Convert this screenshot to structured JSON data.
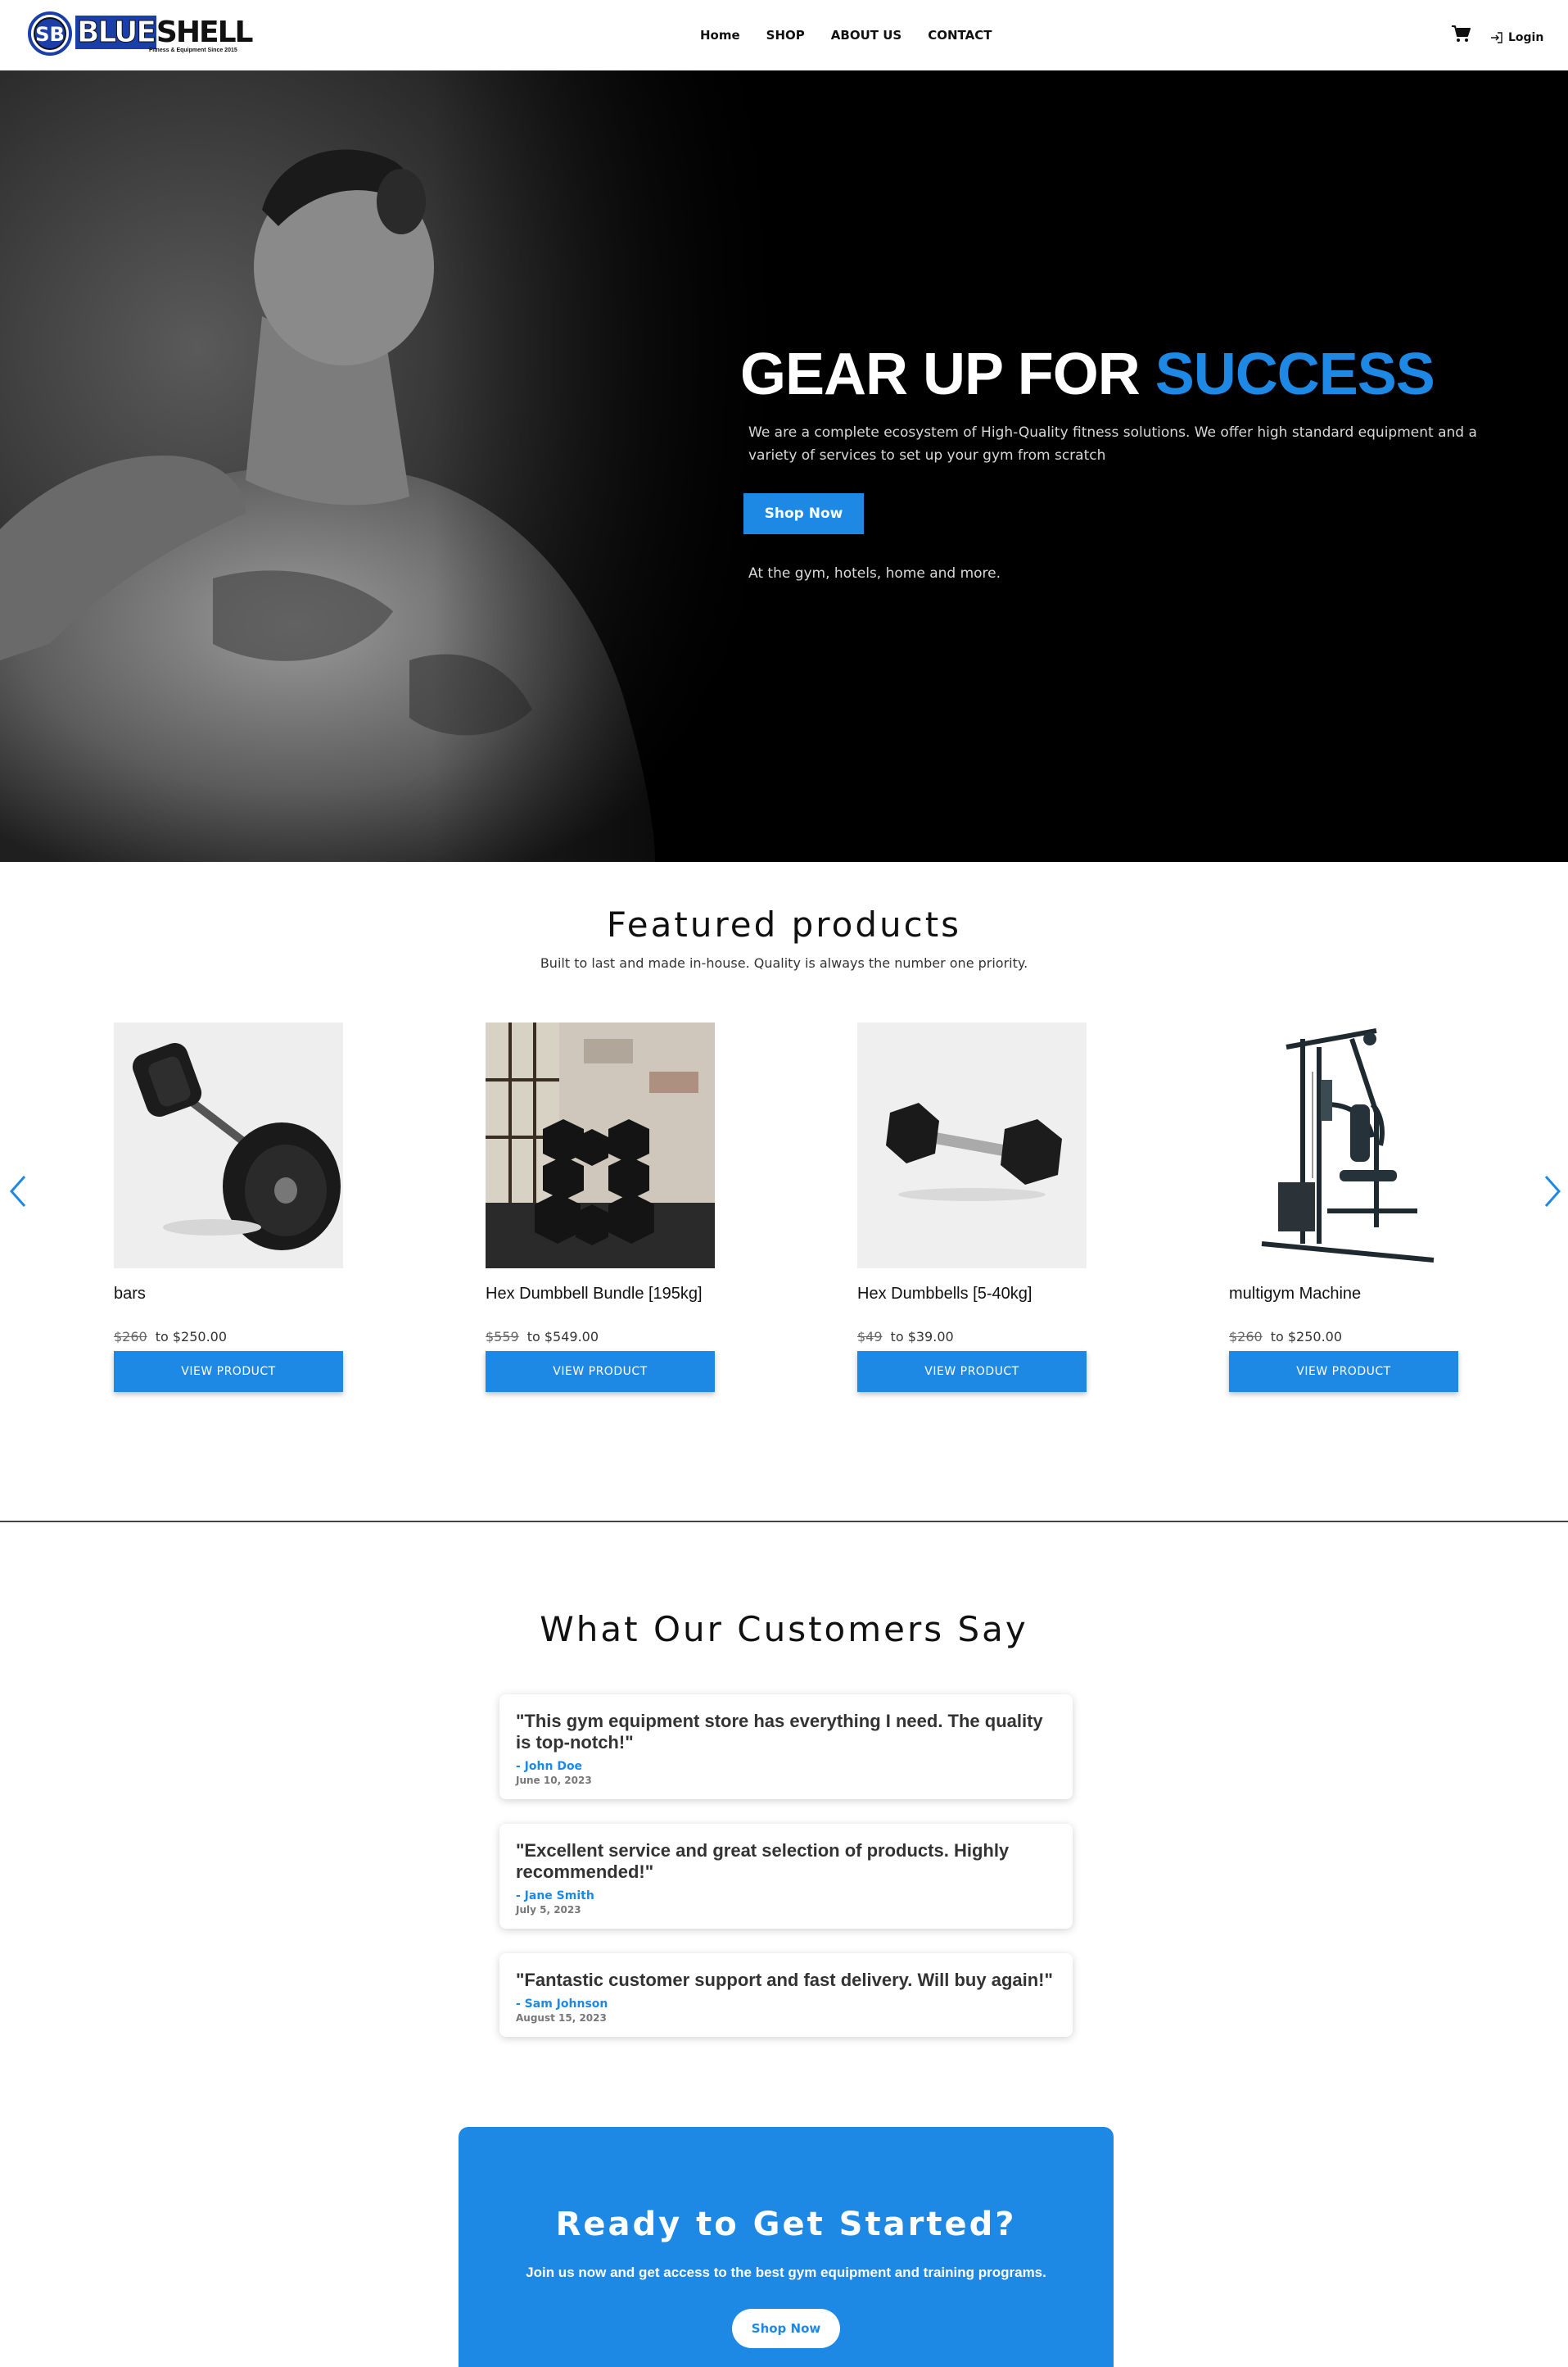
{
  "brand": {
    "logo_text_blue": "BLUE",
    "logo_text_black": "SHELL",
    "logo_tagline": "Fitness & Equipment Since 2015",
    "accent_color": "#1e88e5"
  },
  "nav": {
    "items": [
      {
        "label": "Home"
      },
      {
        "label": "SHOP"
      },
      {
        "label": "ABOUT US"
      },
      {
        "label": "CONTACT"
      }
    ],
    "cart_icon": "cart-icon",
    "login_label": "Login"
  },
  "hero": {
    "title_main": "GEAR UP FOR ",
    "title_accent": "SUCCESS",
    "description": "We are a complete ecosystem of High-Quality fitness solutions. We offer high standard equipment and a variety of services to set up your gym from scratch",
    "button_label": "Shop Now",
    "subtext": "At the gym, hotels, home and more."
  },
  "featured": {
    "title": "Featured products",
    "subtitle": "Built to last and made in-house. Quality is always the number one priority.",
    "products": [
      {
        "name": "bars",
        "old_price": "$260",
        "price": "to $250.00",
        "button": "VIEW PRODUCT",
        "image": "barbell-image"
      },
      {
        "name": "Hex Dumbbell Bundle [195kg]",
        "old_price": "$559",
        "price": "to $549.00",
        "button": "VIEW PRODUCT",
        "image": "dumbbell-bundle-image"
      },
      {
        "name": "Hex Dumbbells [5-40kg]",
        "old_price": "$49",
        "price": "to $39.00",
        "button": "VIEW PRODUCT",
        "image": "hex-dumbbell-image"
      },
      {
        "name": "multigym Machine",
        "old_price": "$260",
        "price": "to $250.00",
        "button": "VIEW PRODUCT",
        "image": "multigym-image"
      }
    ]
  },
  "testimonials": {
    "title": "What Our Customers Say",
    "items": [
      {
        "quote": "\"This gym equipment store has everything I need. The quality is top-notch!\"",
        "author": "- John Doe",
        "date": "June 10, 2023"
      },
      {
        "quote": "\"Excellent service and great selection of products. Highly recommended!\"",
        "author": "- Jane Smith",
        "date": "July 5, 2023"
      },
      {
        "quote": "\"Fantastic customer support and fast delivery. Will buy again!\"",
        "author": "- Sam Johnson",
        "date": "August 15, 2023"
      }
    ]
  },
  "cta": {
    "title": "Ready to Get Started?",
    "subtitle": "Join us now and get access to the best gym equipment and training programs.",
    "button_label": "Shop Now"
  }
}
